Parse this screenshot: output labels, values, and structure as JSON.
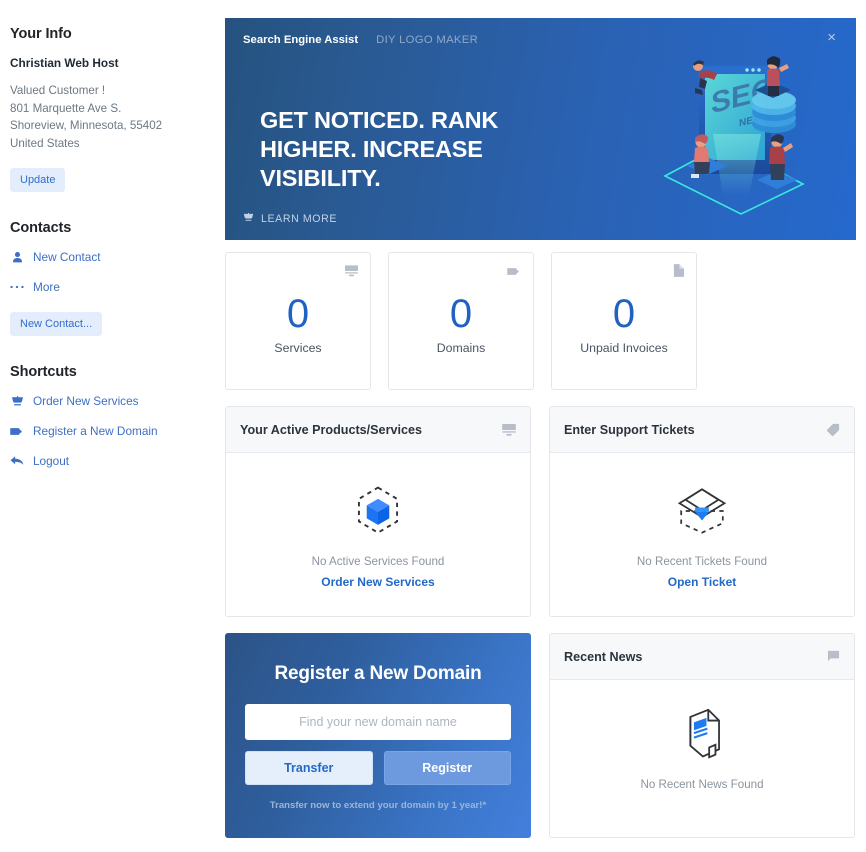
{
  "sidebar": {
    "your_info_heading": "Your Info",
    "account_name": "Christian Web Host",
    "address_lines": [
      "Valued Customer !",
      "801 Marquette Ave S.",
      "Shoreview, Minnesota, 55402",
      "United States"
    ],
    "update_label": "Update",
    "contacts_heading": "Contacts",
    "contact_links": [
      {
        "label": "New Contact",
        "icon": "person-icon"
      },
      {
        "label": "More",
        "icon": "ellipsis-icon"
      }
    ],
    "new_contact_button": "New Contact...",
    "shortcuts_heading": "Shortcuts",
    "shortcut_links": [
      {
        "label": "Order New Services",
        "icon": "cart-icon"
      },
      {
        "label": "Register a New Domain",
        "icon": "tag-icon"
      },
      {
        "label": "Logout",
        "icon": "back-arrow-icon"
      }
    ]
  },
  "banner": {
    "tab_active": "Search Engine Assist",
    "tab_inactive": "DIY LOGO MAKER",
    "close_label": "×",
    "headline": "GET NOTICED. RANK HIGHER. INCREASE VISIBILITY.",
    "cta_label": "LEARN MORE",
    "cta_icon": "cart-icon",
    "art_text": "SEO",
    "art_subtext": "NETWORK",
    "gradient_from": "#25527f",
    "gradient_to": "#2569cd"
  },
  "stats": [
    {
      "value": "0",
      "label": "Services",
      "icon": "server-icon"
    },
    {
      "value": "0",
      "label": "Domains",
      "icon": "tag-icon"
    },
    {
      "value": "0",
      "label": "Unpaid Invoices",
      "icon": "document-icon"
    }
  ],
  "stat_color": "#2062c4",
  "panels": {
    "services": {
      "title": "Your Active Products/Services",
      "icon": "server-icon",
      "empty_text": "No Active Services Found",
      "link_text": "Order New Services",
      "art": "dashed-hexagon-cube-icon"
    },
    "tickets": {
      "title": "Enter Support Tickets",
      "icon": "tag-icon",
      "empty_text": "No Recent Tickets Found",
      "link_text": "Open Ticket",
      "art": "envelope-download-icon"
    },
    "news": {
      "title": "Recent News",
      "icon": "flag-icon",
      "empty_text": "No Recent News Found",
      "art": "newspaper-icon"
    }
  },
  "register_domain": {
    "title": "Register a New Domain",
    "input_value": "",
    "input_placeholder": "Find your new domain name",
    "transfer_label": "Transfer",
    "register_label": "Register",
    "note": "Transfer now to extend your domain by 1 year!*",
    "gradient_from": "#2c5387",
    "gradient_to": "#4380dd"
  }
}
